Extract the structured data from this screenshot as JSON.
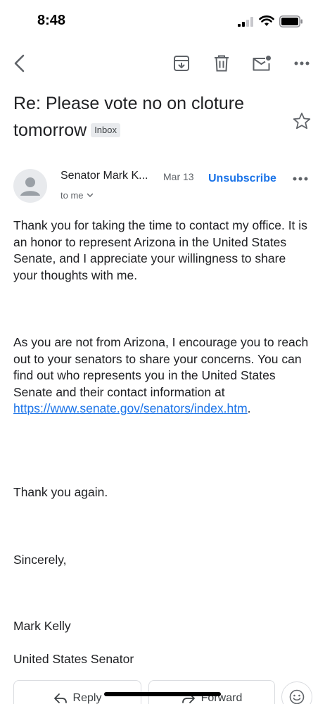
{
  "status_bar": {
    "time": "8:48",
    "signal_icon": "cellular-signal-icon",
    "wifi_icon": "wifi-icon",
    "battery_icon": "battery-icon"
  },
  "toolbar": {
    "back_icon": "chevron-left-icon",
    "archive_icon": "archive-icon",
    "delete_icon": "trash-icon",
    "mark_unread_icon": "mail-unread-icon",
    "more_icon": "more-horizontal-icon"
  },
  "email": {
    "subject": "Re: Please vote no on cloture tomorrow",
    "label": "Inbox",
    "sender": "Senator Mark K...",
    "date": "Mar 13",
    "recipient": "to me",
    "unsubscribe": "Unsubscribe",
    "body": {
      "p1": "Thank you for taking the time to contact my office. It is an honor to represent Arizona in the United States Senate, and I appreciate your willingness to share your thoughts with me.",
      "p2_text": "As you are not from Arizona, I encourage you to reach out to your senators to share your concerns. You can find out who represents you in the United States Senate and their contact information at ",
      "p2_link": "https://www.senate.gov/senators/index.htm",
      "p2_end": ".",
      "p3": "Thank you again.",
      "p4": "Sincerely,",
      "p5": "Mark Kelly",
      "p6": "United States Senator"
    }
  },
  "actions": {
    "reply": "Reply",
    "forward": "Forward",
    "emoji_icon": "emoji-reaction-icon"
  }
}
